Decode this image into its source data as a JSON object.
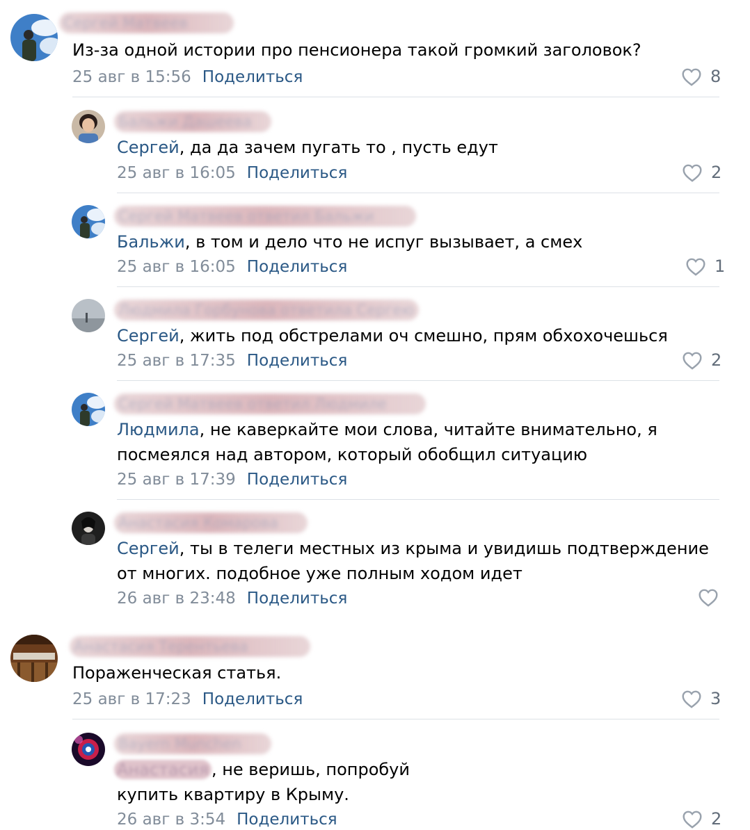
{
  "comments": [
    {
      "author": "Сергей Матвеев",
      "text": "Из-за одной истории про пенсионера такой громкий заголовок?",
      "date": "25 авг в 15:56",
      "share": "Поделиться",
      "likes": "8"
    },
    {
      "author": "Бальжи Дашеева",
      "mention": "Сергей",
      "text": ", да да зачем пугать то , пусть едут",
      "date": "25 авг в 16:05",
      "share": "Поделиться",
      "likes": "2"
    },
    {
      "author": "Сергей Матвеев ответил Бальжи",
      "mention": "Бальжи",
      "text": ", в том и дело что не испуг вызывает, а смех",
      "date": "25 авг в 16:05",
      "share": "Поделиться",
      "likes": "1"
    },
    {
      "author": "Людмила Горбунова ответила Сергею",
      "mention": "Сергей",
      "text": ", жить под обстрелами оч смешно, прям обхохочешься",
      "date": "25 авг в 17:35",
      "share": "Поделиться",
      "likes": "2"
    },
    {
      "author": "Сергей Матвеев ответил Людмиле",
      "mention": "Людмила",
      "text": ", не каверкайте мои слова, читайте внимательно, я",
      "text2": "посмеялся над автором, который обобщил ситуацию",
      "date": "25 авг в 17:39",
      "share": "Поделиться",
      "likes": ""
    },
    {
      "author": "Анастасия Комарова",
      "mention": "Сергей",
      "text": ", ты в телеги местных из крыма и увидишь подтверждение",
      "text2": "от многих. подобное уже полным ходом идет",
      "date": "26 авг в 23:48",
      "share": "Поделиться",
      "likes": ""
    },
    {
      "author": "Анастасия Терентьева",
      "text": "Пораженческая статья.",
      "date": "25 авг в 17:23",
      "share": "Поделиться",
      "likes": "3"
    },
    {
      "author": "Bayern Munchen",
      "mention": "Анастасия",
      "text": ", не веришь, попробуй",
      "text2": "купить квартиру в Крыму.",
      "date": "26 авг в 3:54",
      "share": "Поделиться",
      "likes": "2"
    }
  ],
  "colors": {
    "link": "#2a5885",
    "meta": "#818c99",
    "divider": "#dce1e6"
  }
}
